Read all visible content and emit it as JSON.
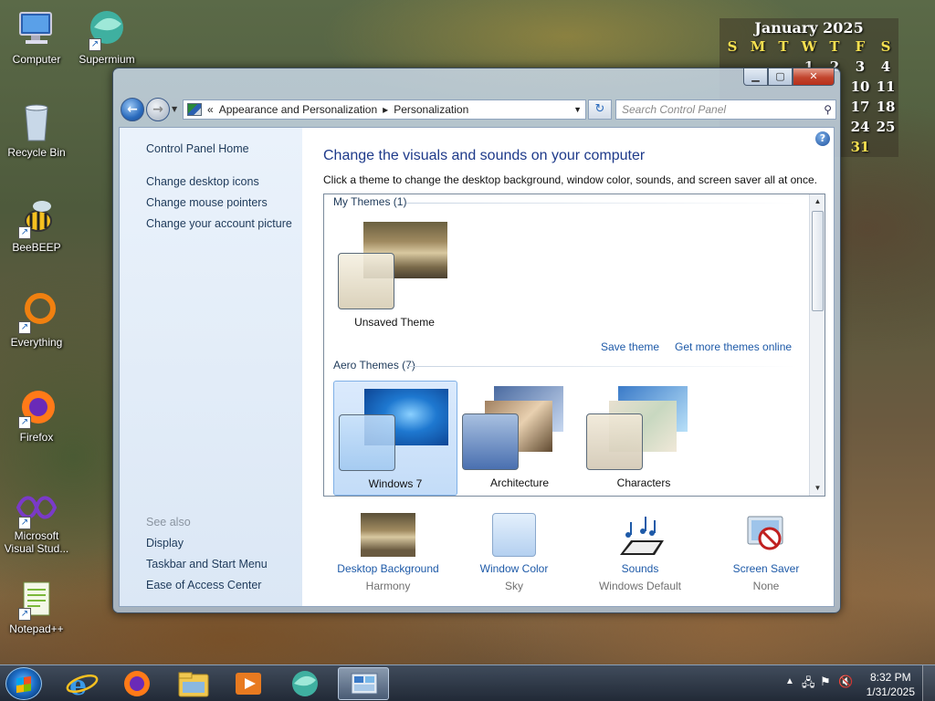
{
  "desktop_icons": [
    {
      "label": "Computer",
      "icon": "computer-icon"
    },
    {
      "label": "Supermium",
      "icon": "supermium-icon"
    },
    {
      "label": "Recycle Bin",
      "icon": "recycle-bin-icon"
    },
    {
      "label": "BeeBEEP",
      "icon": "beebeep-icon"
    },
    {
      "label": "Everything",
      "icon": "everything-icon"
    },
    {
      "label": "Firefox",
      "icon": "firefox-icon"
    },
    {
      "label": "Microsoft Visual Stud...",
      "icon": "visual-studio-icon"
    },
    {
      "label": "Notepad++",
      "icon": "notepadpp-icon"
    }
  ],
  "calendar": {
    "title": "January 2025",
    "weekdays": [
      "S",
      "M",
      "T",
      "W",
      "T",
      "F",
      "S"
    ],
    "rows": [
      [
        "",
        "",
        "",
        "1",
        "2",
        "3",
        "4"
      ],
      [
        "",
        "",
        "",
        "",
        "",
        "10",
        "11"
      ],
      [
        "",
        "",
        "",
        "",
        "",
        "17",
        "18"
      ],
      [
        "",
        "",
        "",
        "",
        "",
        "24",
        "25"
      ],
      [
        "",
        "",
        "",
        "",
        "",
        "31",
        ""
      ]
    ],
    "today": "31"
  },
  "window": {
    "breadcrumb": {
      "overflow": "«",
      "items": [
        "Appearance and Personalization",
        "Personalization"
      ],
      "separator": "▸"
    },
    "search_placeholder": "Search Control Panel",
    "left_pane": {
      "home": "Control Panel Home",
      "links": [
        "Change desktop icons",
        "Change mouse pointers",
        "Change your account picture"
      ],
      "see_also_label": "See also",
      "see_also": [
        "Display",
        "Taskbar and Start Menu",
        "Ease of Access Center"
      ]
    },
    "title": "Change the visuals and sounds on your computer",
    "description": "Click a theme to change the desktop background, window color, sounds, and screen saver all at once.",
    "my_themes": {
      "label": "My Themes (1)",
      "items": [
        {
          "name": "Unsaved Theme"
        }
      ],
      "save_link": "Save theme",
      "more_link": "Get more themes online"
    },
    "aero_themes": {
      "label": "Aero Themes (7)",
      "items": [
        {
          "name": "Windows 7",
          "selected": true
        },
        {
          "name": "Architecture",
          "selected": false
        },
        {
          "name": "Characters",
          "selected": false
        }
      ]
    },
    "bottom": [
      {
        "name": "Desktop Background",
        "value": "Harmony",
        "icon": "desktop-background-icon"
      },
      {
        "name": "Window Color",
        "value": "Sky",
        "icon": "window-color-icon"
      },
      {
        "name": "Sounds",
        "value": "Windows Default",
        "icon": "sounds-icon"
      },
      {
        "name": "Screen Saver",
        "value": "None",
        "icon": "screen-saver-icon"
      }
    ]
  },
  "taskbar": {
    "pinned": [
      "internet-explorer-icon",
      "firefox-icon",
      "file-explorer-icon",
      "media-player-icon",
      "supermium-icon",
      "control-panel-icon"
    ],
    "time": "8:32 PM",
    "date": "1/31/2025"
  }
}
